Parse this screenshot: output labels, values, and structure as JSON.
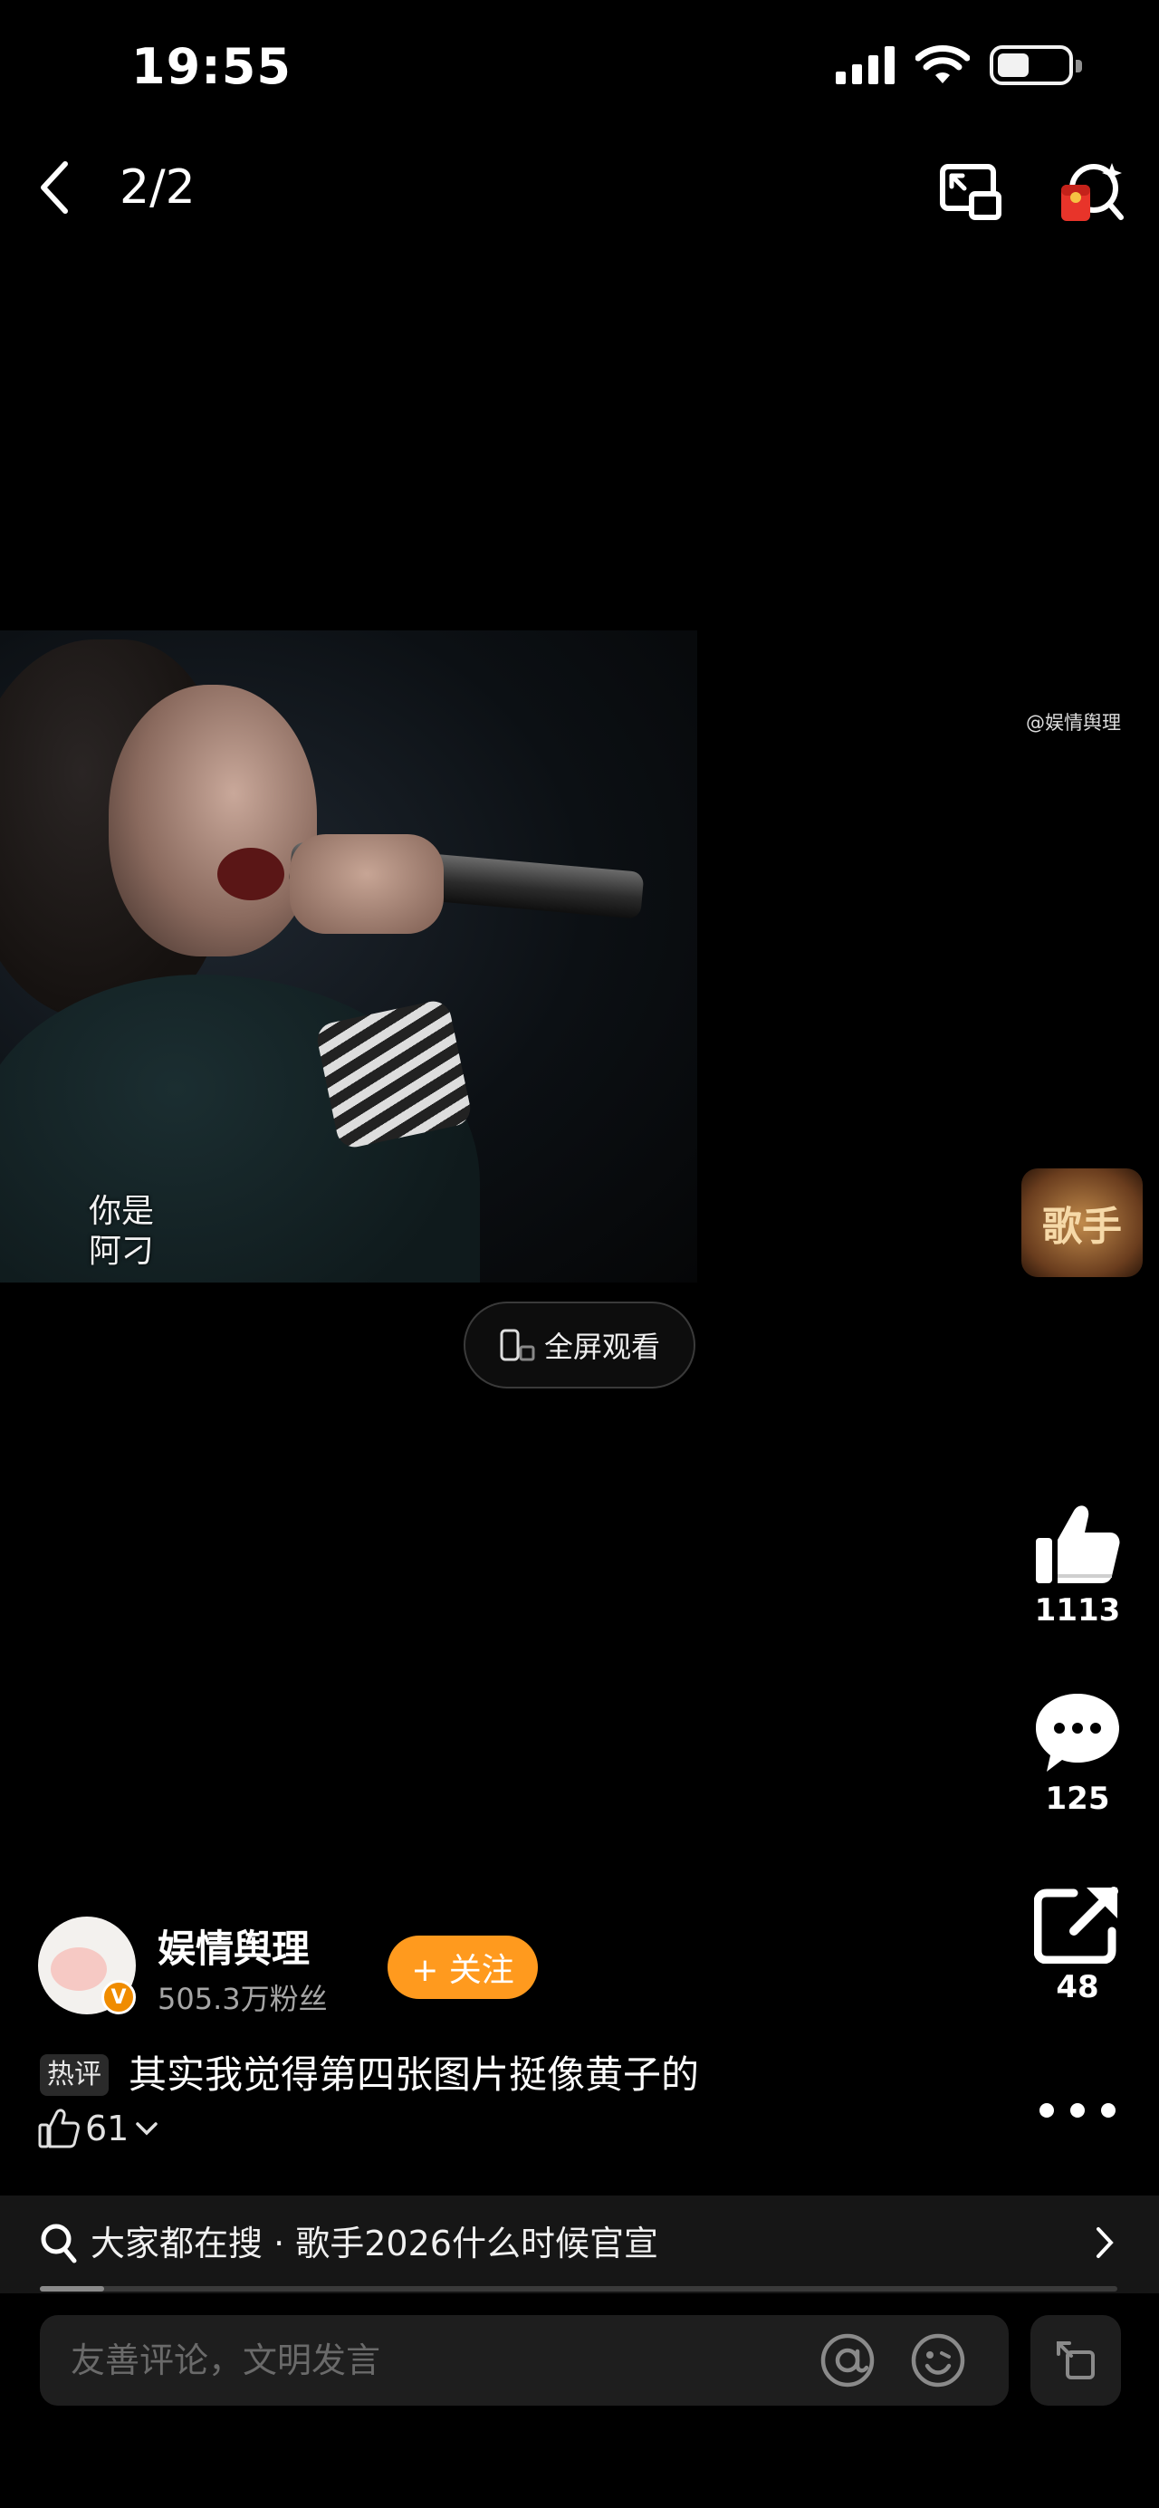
{
  "status_bar": {
    "time": "19:55"
  },
  "nav": {
    "pager": "2/2"
  },
  "media": {
    "caption_line1": "你是",
    "caption_line2": "阿刁",
    "watermark": "@娱情舆理",
    "show_logo_text": "歌手"
  },
  "fullscreen": {
    "label": "全屏观看"
  },
  "actions": {
    "like_count": "1113",
    "comment_count": "125",
    "share_count": "48"
  },
  "author": {
    "name": "娱情舆理",
    "fans": "505.3万粉丝",
    "follow_label": "+ 关注",
    "verified_mark": "V"
  },
  "hot_comment": {
    "tag": "热评",
    "text": "其实我觉得第四张图片挺像黄子的",
    "like_count": "61"
  },
  "search": {
    "text": "大家都在搜 · 歌手2026什么时候官宣",
    "progress": 0.06
  },
  "comment_input": {
    "placeholder": "友善评论，文明发言"
  },
  "colors": {
    "accent": "#ff9a1e",
    "background": "#000000"
  }
}
